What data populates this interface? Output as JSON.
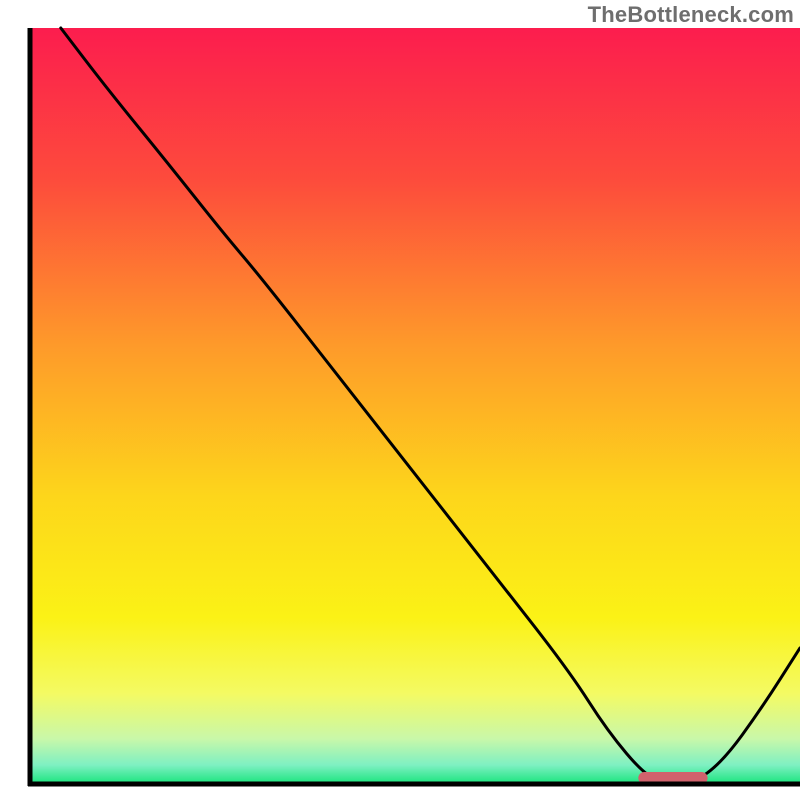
{
  "watermark": "TheBottleneck.com",
  "chart_data": {
    "type": "line",
    "title": "",
    "xlabel": "",
    "ylabel": "",
    "xlim": [
      0,
      100
    ],
    "ylim": [
      0,
      100
    ],
    "series": [
      {
        "name": "bottleneck-curve",
        "x": [
          4,
          10,
          18,
          25,
          30,
          40,
          50,
          60,
          70,
          75,
          80,
          83,
          86,
          90,
          95,
          100
        ],
        "values": [
          100,
          92,
          82,
          73,
          67,
          54,
          41,
          28,
          15,
          7,
          1,
          0,
          0,
          3,
          10,
          18
        ]
      }
    ],
    "indicator": {
      "name": "optimal-zone",
      "x_start": 79,
      "x_end": 88,
      "y": 0.8,
      "color": "#d1626c"
    },
    "gradient_stops": [
      {
        "offset": 0,
        "color": "#fc1d4e"
      },
      {
        "offset": 0.2,
        "color": "#fd4b3c"
      },
      {
        "offset": 0.42,
        "color": "#fe9a2a"
      },
      {
        "offset": 0.62,
        "color": "#fdd61b"
      },
      {
        "offset": 0.78,
        "color": "#fbf216"
      },
      {
        "offset": 0.88,
        "color": "#f4fa63"
      },
      {
        "offset": 0.94,
        "color": "#c9f8a9"
      },
      {
        "offset": 0.975,
        "color": "#7ef0c2"
      },
      {
        "offset": 1.0,
        "color": "#18e47c"
      }
    ]
  }
}
